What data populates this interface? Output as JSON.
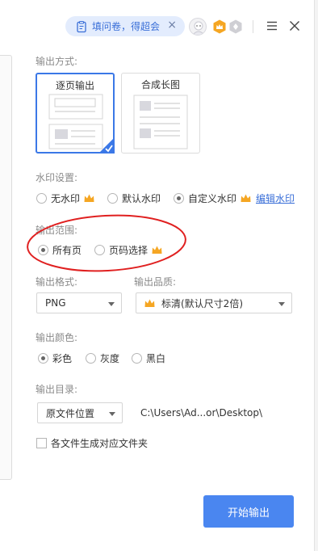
{
  "topbar": {
    "survey_label": "填问卷，得超会",
    "close_glyph": "×"
  },
  "output_mode": {
    "title": "输出方式:",
    "options": [
      "逐页输出",
      "合成长图"
    ],
    "selected": "逐页输出"
  },
  "watermark": {
    "title": "水印设置:",
    "options": [
      "无水印",
      "默认水印",
      "自定义水印"
    ],
    "selected": "自定义水印",
    "edit_link": "编辑水印"
  },
  "range": {
    "title": "输出范围:",
    "options": [
      "所有页",
      "页码选择"
    ],
    "selected": "所有页"
  },
  "format": {
    "title": "输出格式:",
    "value": "PNG"
  },
  "quality": {
    "title": "输出品质:",
    "value": "标清(默认尺寸2倍)"
  },
  "color": {
    "title": "输出颜色:",
    "options": [
      "彩色",
      "灰度",
      "黑白"
    ],
    "selected": "彩色"
  },
  "directory": {
    "title": "输出目录:",
    "select_value": "原文件位置",
    "path": "C:\\Users\\Ad...or\\Desktop\\",
    "subfolder_label": "各文件生成对应文件夹"
  },
  "start_button": "开始输出",
  "colors": {
    "accent": "#3b78e7",
    "button": "#4a86f0",
    "crown": "#f5a623",
    "annotation": "#e02020"
  }
}
